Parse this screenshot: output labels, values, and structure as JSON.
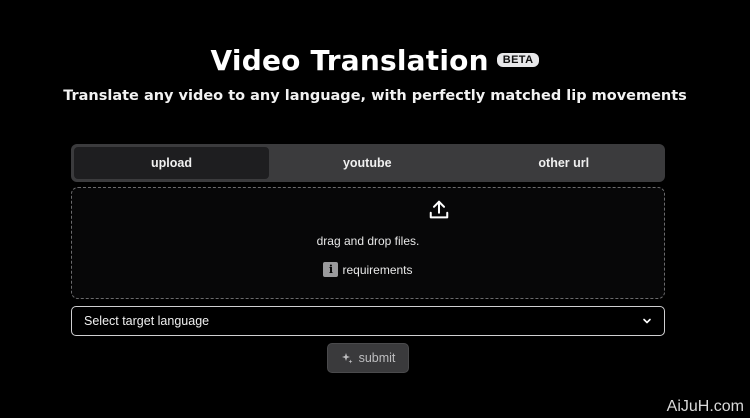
{
  "header": {
    "title": "Video Translation",
    "badge": "BETA",
    "subtitle": "Translate any video to any language, with perfectly matched lip movements"
  },
  "tabs": [
    {
      "label": "upload",
      "active": true
    },
    {
      "label": "youtube",
      "active": false
    },
    {
      "label": "other url",
      "active": false
    }
  ],
  "dropzone": {
    "icon": "upload-icon",
    "text": "drag and drop files.",
    "requirements_label": "requirements",
    "requirements_icon": "info-icon"
  },
  "language_select": {
    "value": "Select target language",
    "icon": "chevron-down-icon"
  },
  "submit": {
    "label": "submit",
    "icon": "sparkle-icon"
  },
  "watermark": "AiJuH.com"
}
